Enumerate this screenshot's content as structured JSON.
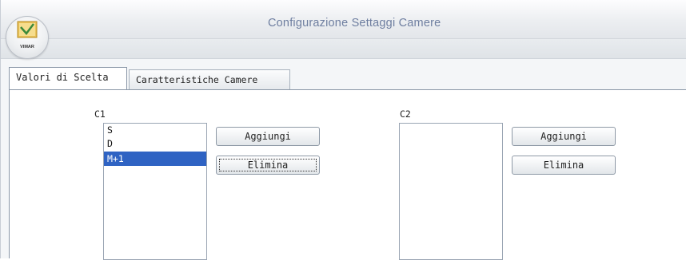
{
  "window": {
    "title": "Configurazione Settaggi Camere",
    "logo_text": "VIMAR"
  },
  "tabs": [
    {
      "label": "Valori di Scelta",
      "active": true
    },
    {
      "label": "Caratteristiche Camere",
      "active": false
    }
  ],
  "groups": [
    {
      "label": "C1",
      "items": [
        {
          "text": "S",
          "selected": false
        },
        {
          "text": "D",
          "selected": false
        },
        {
          "text": "M+1",
          "selected": true
        }
      ],
      "add_label": "Aggiungi",
      "delete_label": "Elimina"
    },
    {
      "label": "C2",
      "items": [],
      "add_label": "Aggiungi",
      "delete_label": "Elimina"
    }
  ],
  "colors": {
    "selection": "#2f63c3",
    "title_text": "#6e7ea0"
  }
}
